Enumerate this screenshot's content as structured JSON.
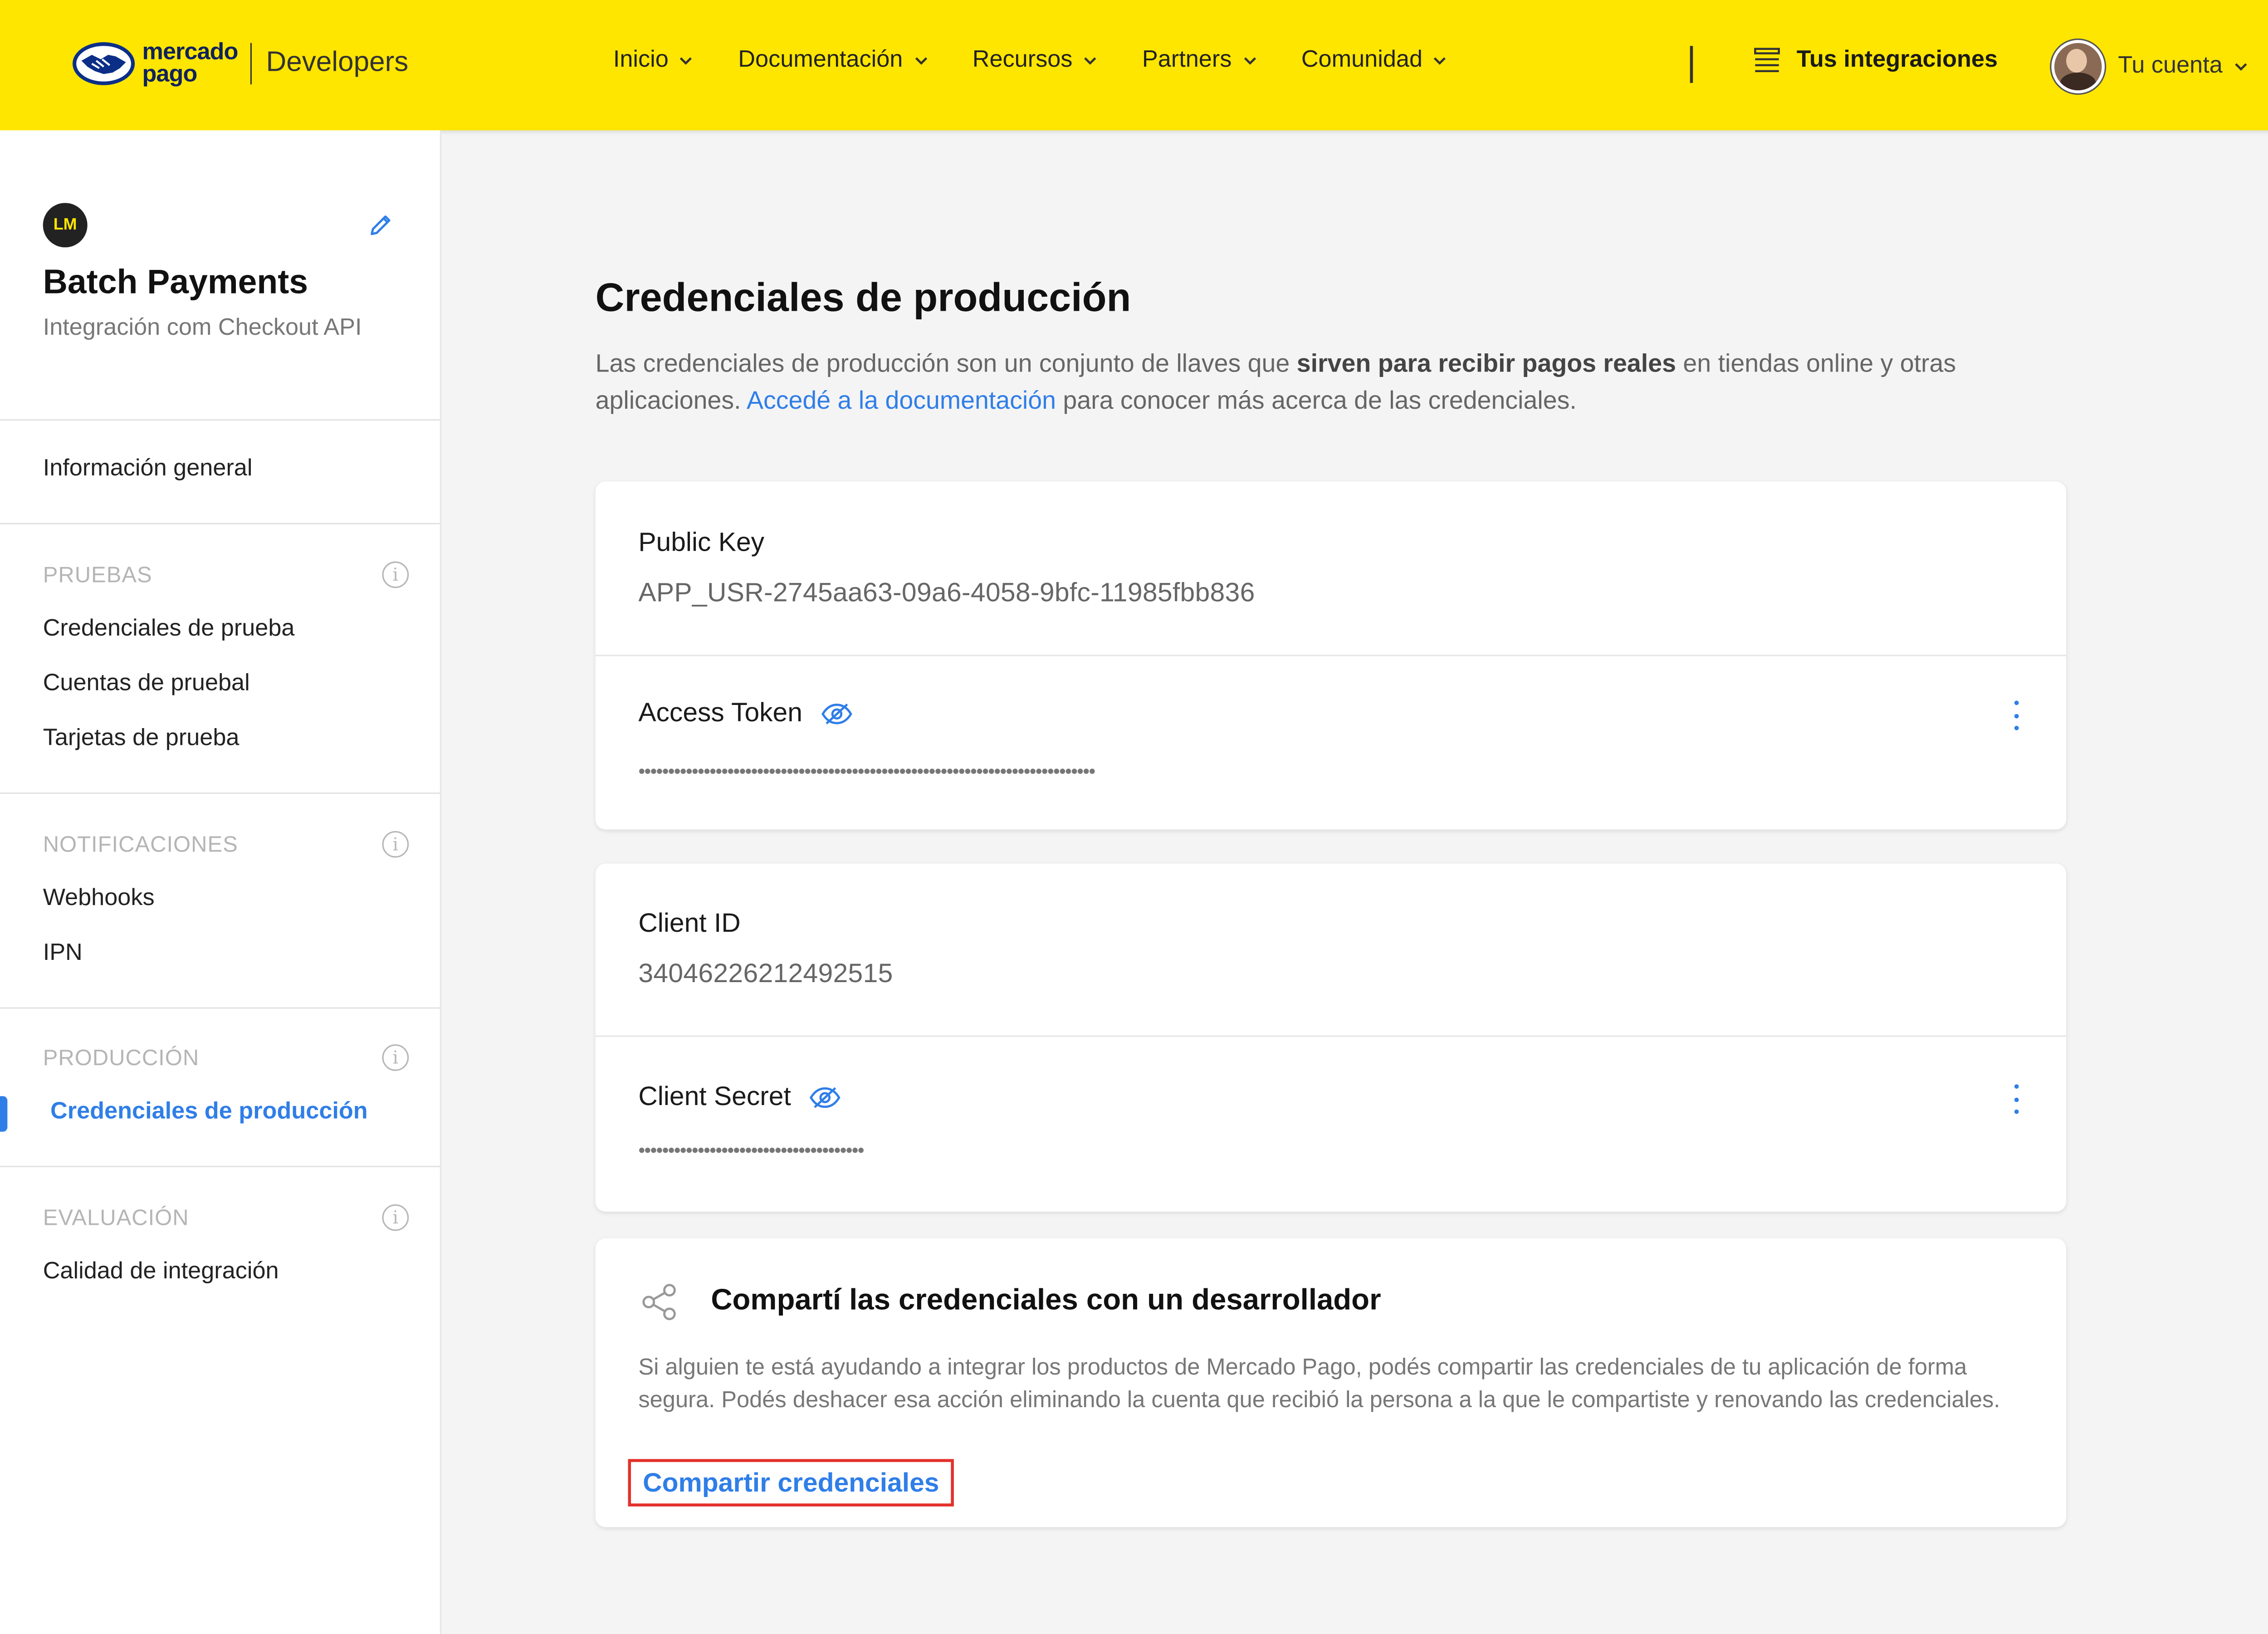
{
  "header": {
    "logo_line1": "mercado",
    "logo_line2": "pago",
    "developers_label": "Developers",
    "nav": [
      "Inicio",
      "Documentación",
      "Recursos",
      "Partners",
      "Comunidad"
    ],
    "integrations_label": "Tus integraciones",
    "account_label": "Tu cuenta"
  },
  "sidebar": {
    "app_initials": "LM",
    "app_name": "Batch Payments",
    "app_subtitle": "Integración com Checkout API",
    "general_label": "Información general",
    "sections": [
      {
        "title": "PRUEBAS",
        "items": [
          "Credenciales de prueba",
          "Cuentas de pruebal",
          "Tarjetas de prueba"
        ]
      },
      {
        "title": "NOTIFICACIONES",
        "items": [
          "Webhooks",
          "IPN"
        ]
      },
      {
        "title": "PRODUCCIÓN",
        "items": [
          "Credenciales de producción"
        ]
      },
      {
        "title": "EVALUACIÓN",
        "items": [
          "Calidad de integración"
        ]
      }
    ],
    "active_item": "Credenciales de producción",
    "info_glyph": "i"
  },
  "main": {
    "title": "Credenciales de producción",
    "desc_part1": "Las credenciales de producción son un conjunto de llaves que ",
    "desc_bold": "sirven para recibir pagos reales",
    "desc_part2": " en tiendas online y otras aplicaciones. ",
    "desc_link": "Accedé a la documentación",
    "desc_part3": " para conocer más acerca de las credenciales.",
    "public_key_label": "Public Key",
    "public_key_value": "APP_USR-2745aa63-09a6-4058-9bfc-11985fbb836",
    "access_token_label": "Access Token",
    "access_token_masked": "•••••••••••••••••••••••••••••••••••••••••••••••••••••••••••••••••••••••••••••",
    "client_id_label": "Client ID",
    "client_id_value": "34046226212492515",
    "client_secret_label": "Client Secret",
    "client_secret_masked": "••••••••••••••••••••••••••••••••••••••",
    "share_title": "Compartí las credenciales con un desarrollador",
    "share_desc": "Si alguien te está ayudando a integrar los productos de Mercado Pago, podés compartir las credenciales de tu aplicación de forma segura. Podés deshacer esa acción eliminando la cuenta que recibió la persona a la que le compartiste y renovando las credenciales.",
    "share_button": "Compartir credenciales"
  },
  "colors": {
    "header_bg": "#ffe600",
    "accent_blue": "#2f7ee8",
    "highlight_red": "#e4312b"
  }
}
